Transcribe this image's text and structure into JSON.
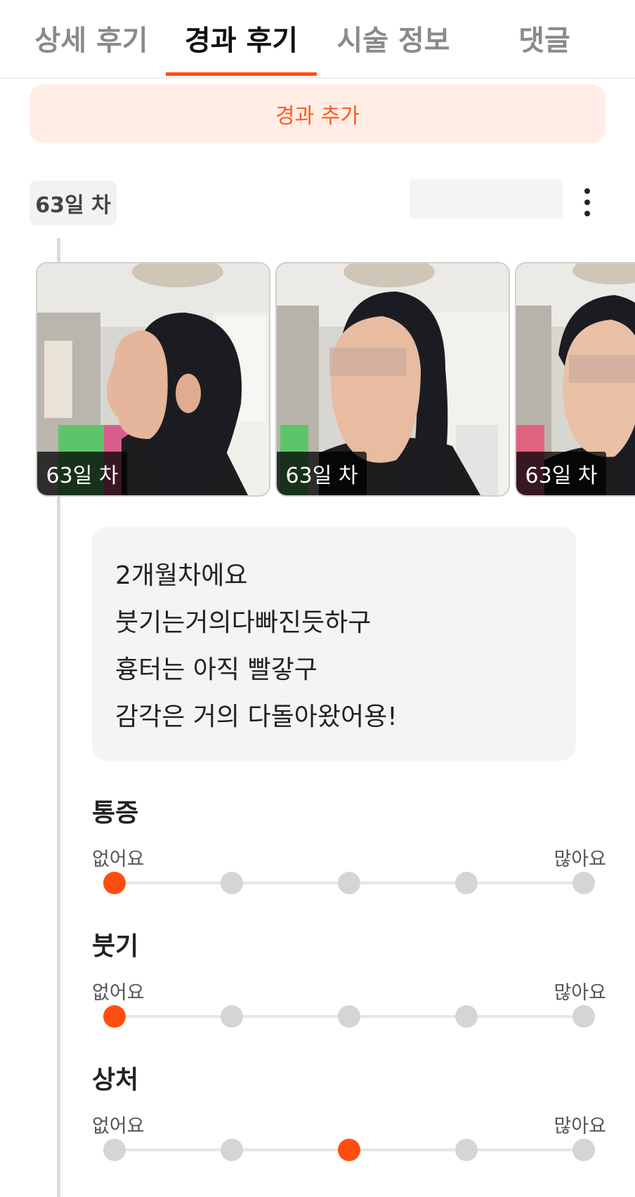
{
  "tabs": [
    {
      "label": "상세 후기",
      "active": false
    },
    {
      "label": "경과 후기",
      "active": true
    },
    {
      "label": "시술 정보",
      "active": false
    },
    {
      "label": "댓글",
      "active": false
    }
  ],
  "add_button": {
    "label": "경과 추가"
  },
  "entry": {
    "day_label": "63일 차",
    "more_icon": "more-vertical-icon",
    "photos": [
      {
        "label": "63일 차"
      },
      {
        "label": "63일 차"
      },
      {
        "label": "63일 차"
      }
    ],
    "memo_lines": [
      "2개월차에요",
      "붓기는거의다빠진듯하구",
      "흉터는 아직 빨갛구",
      "감각은 거의 다돌아왔어용!"
    ]
  },
  "ratings": [
    {
      "title": "통증",
      "min_label": "없어요",
      "max_label": "많아요",
      "value": 1,
      "scale": 5
    },
    {
      "title": "붓기",
      "min_label": "없어요",
      "max_label": "많아요",
      "value": 1,
      "scale": 5
    },
    {
      "title": "상처",
      "min_label": "없어요",
      "max_label": "많아요",
      "value": 3,
      "scale": 5
    }
  ],
  "colors": {
    "accent": "#ff4e0f",
    "accent_bg": "#ffede6",
    "dot_inactive": "#d5d5d5"
  }
}
